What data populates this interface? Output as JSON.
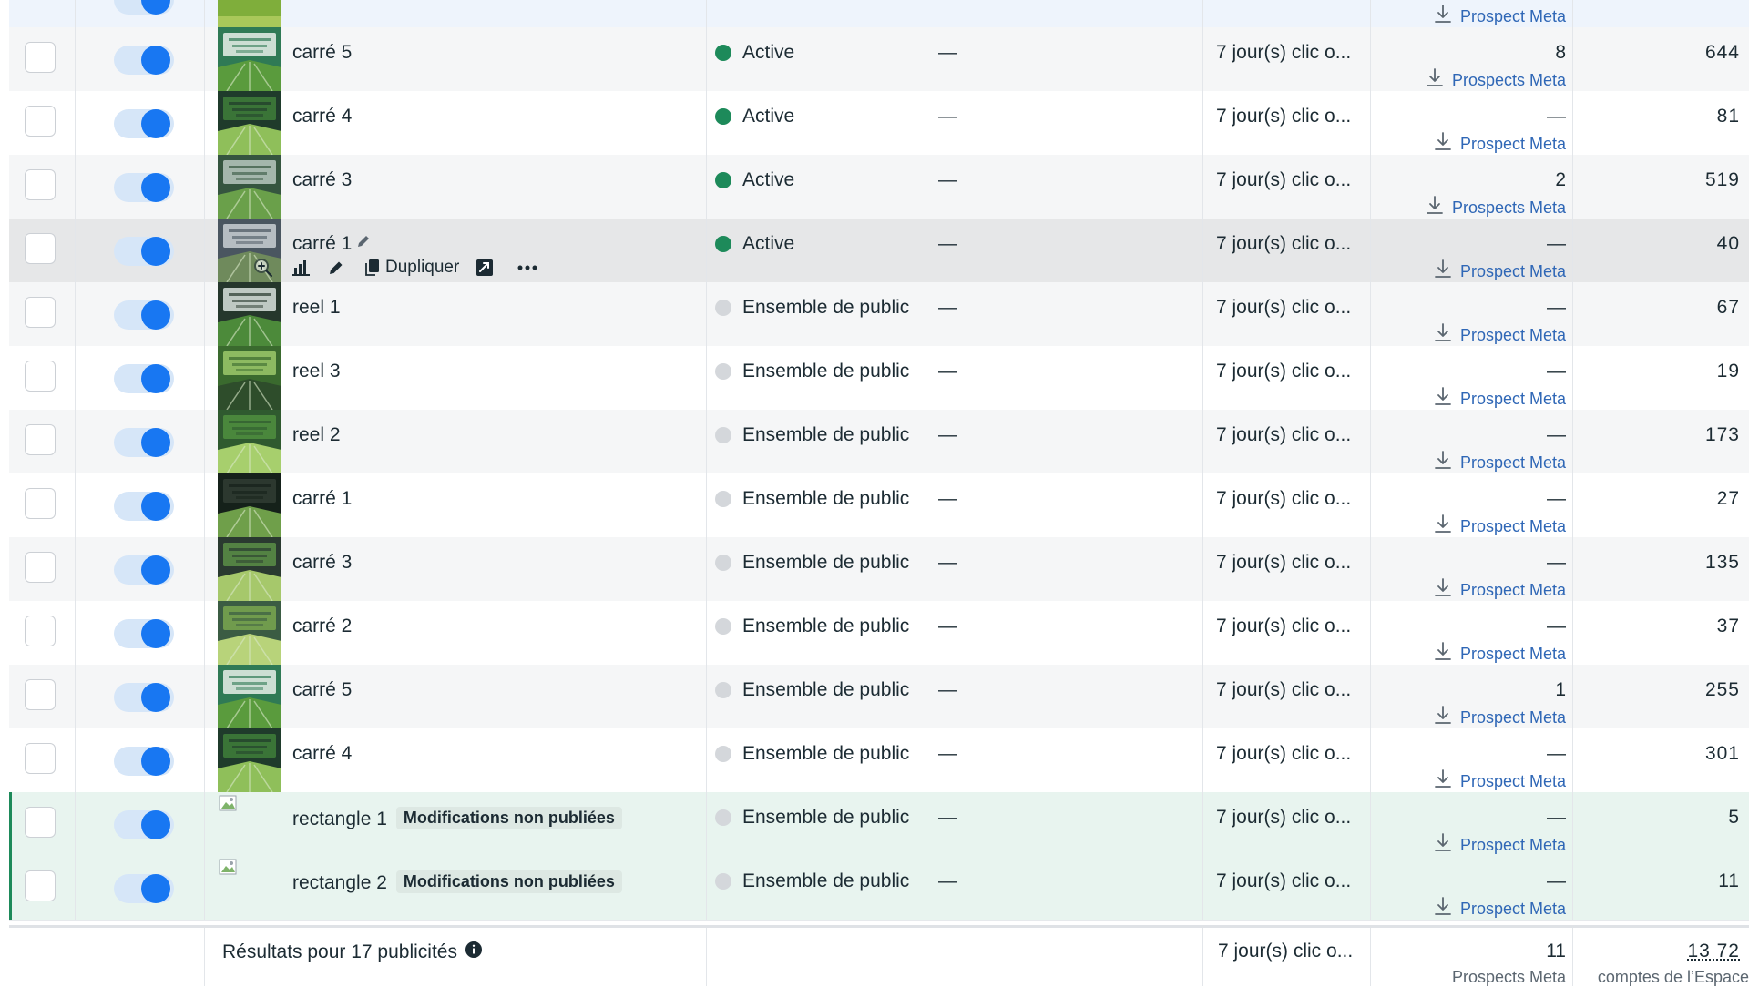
{
  "colors": {
    "active_dot": "#1d8a5a",
    "inactive_dot": "#d4d7db",
    "toggle_on": "#1877f2",
    "link": "#2f67b6",
    "unpublished_bg": "#e8f4ef"
  },
  "top_row": {
    "prospect": "Prospect Meta"
  },
  "rows": [
    {
      "name": "carré 5",
      "status": "Active",
      "status_kind": "active",
      "dash": "—",
      "attribution": "7 jour(s) clic o...",
      "results": "8",
      "prospect": "Prospects Meta",
      "reach": "644"
    },
    {
      "name": "carré 4",
      "status": "Active",
      "status_kind": "active",
      "dash": "—",
      "attribution": "7 jour(s) clic o...",
      "results": "—",
      "prospect": "Prospect Meta",
      "reach": "81"
    },
    {
      "name": "carré 3",
      "status": "Active",
      "status_kind": "active",
      "dash": "—",
      "attribution": "7 jour(s) clic o...",
      "results": "2",
      "prospect": "Prospects Meta",
      "reach": "519"
    },
    {
      "name": "carré 1",
      "status": "Active",
      "status_kind": "active",
      "dash": "—",
      "attribution": "7 jour(s) clic o...",
      "results": "—",
      "prospect": "Prospect Meta",
      "reach": "40",
      "hover_actions": {
        "duplicate_label": "Dupliquer"
      }
    },
    {
      "name": "reel 1",
      "status": "Ensemble de public",
      "status_kind": "inactive",
      "dash": "—",
      "attribution": "7 jour(s) clic o...",
      "results": "—",
      "prospect": "Prospect Meta",
      "reach": "67"
    },
    {
      "name": "reel 3",
      "status": "Ensemble de public",
      "status_kind": "inactive",
      "dash": "—",
      "attribution": "7 jour(s) clic o...",
      "results": "—",
      "prospect": "Prospect Meta",
      "reach": "19"
    },
    {
      "name": "reel 2",
      "status": "Ensemble de public",
      "status_kind": "inactive",
      "dash": "—",
      "attribution": "7 jour(s) clic o...",
      "results": "—",
      "prospect": "Prospect Meta",
      "reach": "173"
    },
    {
      "name": "carré 1",
      "status": "Ensemble de public",
      "status_kind": "inactive",
      "dash": "—",
      "attribution": "7 jour(s) clic o...",
      "results": "—",
      "prospect": "Prospect Meta",
      "reach": "27"
    },
    {
      "name": "carré 3",
      "status": "Ensemble de public",
      "status_kind": "inactive",
      "dash": "—",
      "attribution": "7 jour(s) clic o...",
      "results": "—",
      "prospect": "Prospect Meta",
      "reach": "135"
    },
    {
      "name": "carré 2",
      "status": "Ensemble de public",
      "status_kind": "inactive",
      "dash": "—",
      "attribution": "7 jour(s) clic o...",
      "results": "—",
      "prospect": "Prospect Meta",
      "reach": "37"
    },
    {
      "name": "carré 5",
      "status": "Ensemble de public",
      "status_kind": "inactive",
      "dash": "—",
      "attribution": "7 jour(s) clic o...",
      "results": "1",
      "prospect": "Prospect Meta",
      "reach": "255"
    },
    {
      "name": "carré 4",
      "status": "Ensemble de public",
      "status_kind": "inactive",
      "dash": "—",
      "attribution": "7 jour(s) clic o...",
      "results": "—",
      "prospect": "Prospect Meta",
      "reach": "301"
    },
    {
      "name": "rectangle 1",
      "badge": "Modifications non publiées",
      "status": "Ensemble de public",
      "status_kind": "inactive",
      "dash": "—",
      "attribution": "7 jour(s) clic o...",
      "results": "—",
      "prospect": "Prospect Meta",
      "reach": "5"
    },
    {
      "name": "rectangle 2",
      "badge": "Modifications non publiées",
      "status": "Ensemble de public",
      "status_kind": "inactive",
      "dash": "—",
      "attribution": "7 jour(s) clic o...",
      "results": "—",
      "prospect": "Prospect Meta",
      "reach": "11"
    }
  ],
  "footer": {
    "label": "Résultats pour 17 publicités",
    "attribution": "7 jour(s) clic o...",
    "results": "11",
    "results_sub": "Prospects Meta",
    "reach": "13 72",
    "reach_sub": "comptes de l’Espace"
  }
}
